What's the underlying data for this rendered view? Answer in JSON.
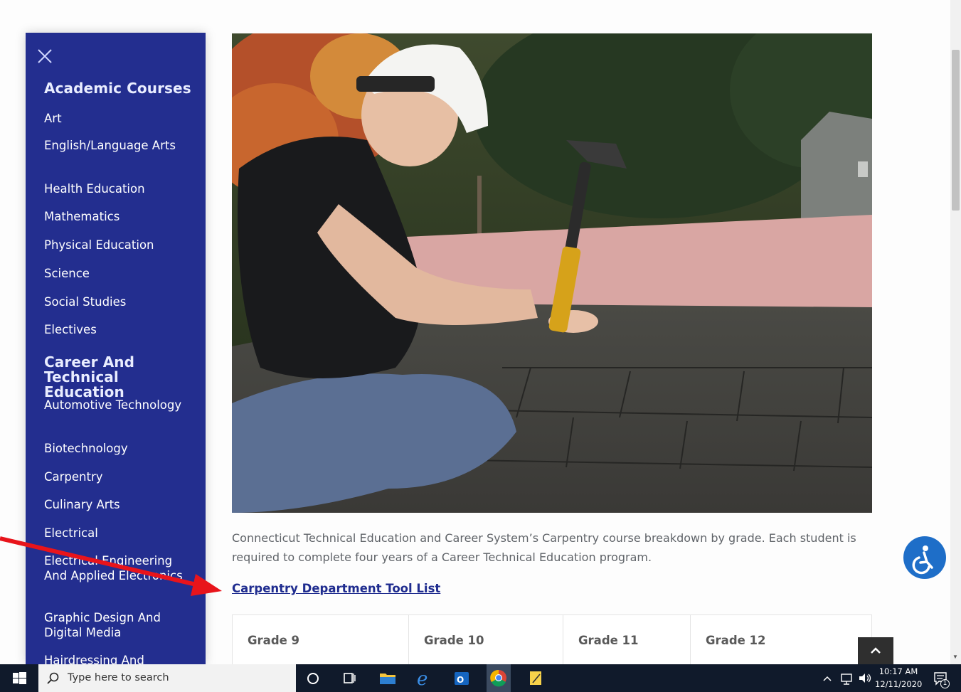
{
  "sidebar": {
    "close_label": "Close menu",
    "academic_heading": "Academic Courses",
    "academic_items": [
      "Art",
      "English/Language Arts",
      "Health Education",
      "Mathematics",
      "Physical Education",
      "Science",
      "Social Studies",
      "Electives"
    ],
    "cte_heading": "Career And Technical Education",
    "cte_items": [
      "Automotive Technology",
      "Biotechnology",
      "Carpentry",
      "Culinary Arts",
      "Electrical",
      "Electrical Engineering And Applied Electronics",
      "Graphic Design And Digital Media",
      "Hairdressing And"
    ]
  },
  "main": {
    "caption": "Connecticut Technical Education and Career System’s Carpentry course breakdown by grade. Each student is required to complete four years of a Career Technical Education program.",
    "tool_link": "Carpentry Department Tool List",
    "grades": [
      "Grade 9",
      "Grade 10",
      "Grade 11",
      "Grade 12"
    ]
  },
  "taskbar": {
    "search_placeholder": "Type here to search",
    "time": "10:17 AM",
    "date": "12/11/2020",
    "notification_count": "1"
  },
  "colors": {
    "sidebar_bg": "#232e8f",
    "link": "#1f2c8f",
    "accessibility": "#1e6ec8",
    "annotation_arrow": "#e8141b",
    "taskbar": "#101a2b"
  },
  "icons": [
    "close-icon",
    "accessibility-icon",
    "chevron-up-icon",
    "windows-icon",
    "search-icon",
    "cortana-icon",
    "task-view-icon",
    "file-explorer-icon",
    "edge-icon",
    "outlook-icon",
    "chrome-icon",
    "sticky-notes-icon",
    "chevron-up-tray-icon",
    "network-icon",
    "volume-icon",
    "notification-icon"
  ]
}
